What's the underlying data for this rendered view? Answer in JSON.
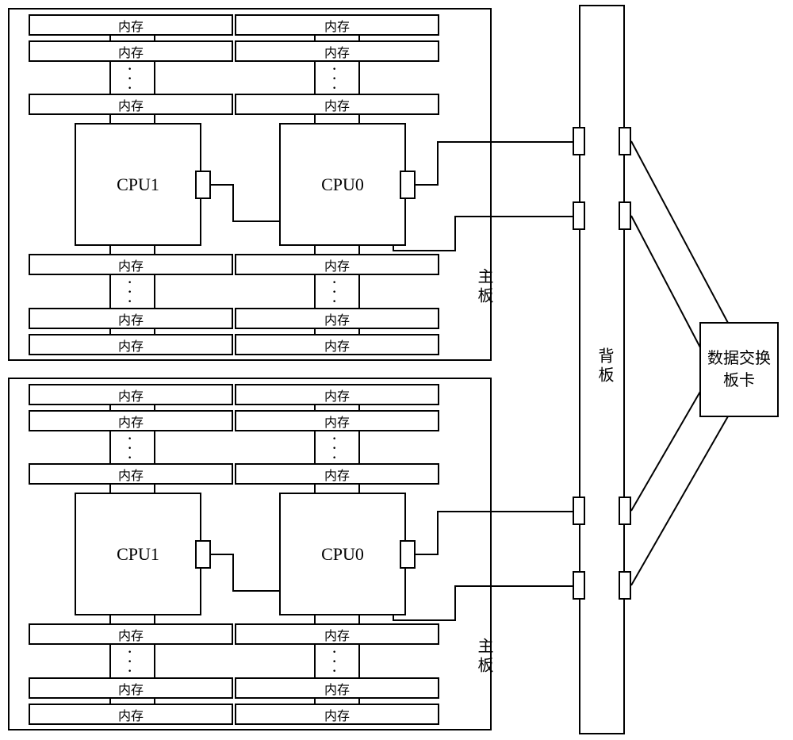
{
  "labels": {
    "memory": "内存",
    "cpu0": "CPU0",
    "cpu1": "CPU1",
    "motherboard": "主板",
    "backplane": "背板",
    "switch_card": "数据交换板卡"
  },
  "chart_data": {
    "type": "diagram",
    "title": "",
    "components": [
      {
        "id": "motherboard-0",
        "type": "motherboard",
        "children": [
          "cpu0-0",
          "cpu1-0"
        ],
        "memory_banks_per_cpu": 2,
        "memory_modules_per_bank": "multiple",
        "connectors_to_backplane": 2
      },
      {
        "id": "motherboard-1",
        "type": "motherboard",
        "children": [
          "cpu0-1",
          "cpu1-1"
        ],
        "memory_banks_per_cpu": 2,
        "memory_modules_per_bank": "multiple",
        "connectors_to_backplane": 2
      },
      {
        "id": "cpu0-0",
        "type": "cpu",
        "label": "CPU0"
      },
      {
        "id": "cpu1-0",
        "type": "cpu",
        "label": "CPU1"
      },
      {
        "id": "cpu0-1",
        "type": "cpu",
        "label": "CPU0"
      },
      {
        "id": "cpu1-1",
        "type": "cpu",
        "label": "CPU1"
      },
      {
        "id": "backplane",
        "type": "backplane"
      },
      {
        "id": "data-switch-card",
        "type": "switch-card"
      }
    ],
    "connections": [
      {
        "from": "cpu1-0",
        "to": "cpu0-0"
      },
      {
        "from": "cpu1-1",
        "to": "cpu0-1"
      },
      {
        "from": "cpu0-0",
        "to": "backplane",
        "count": 2
      },
      {
        "from": "cpu0-1",
        "to": "backplane",
        "count": 2
      },
      {
        "from": "backplane",
        "to": "data-switch-card",
        "count": 4
      }
    ]
  }
}
